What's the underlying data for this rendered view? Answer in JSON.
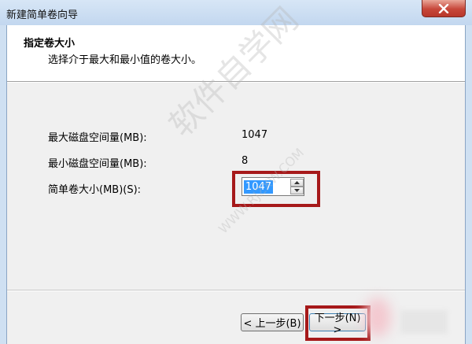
{
  "window": {
    "title": "新建简单卷向导",
    "close_icon": "close-x-icon"
  },
  "header": {
    "title": "指定卷大小",
    "subtitle": "选择介于最大和最小值的卷大小。"
  },
  "fields": {
    "max_label": "最大磁盘空间量(MB):",
    "max_value": "1047",
    "min_label": "最小磁盘空间量(MB):",
    "min_value": "8",
    "size_label": "简单卷大小(MB)(S):",
    "size_value": "1047"
  },
  "buttons": {
    "back_label": "< 上一步(B)",
    "next_label": "下一步(N) >"
  },
  "watermark": {
    "text": "软件自学网",
    "url": "WWW.RJZXW.COM"
  },
  "colors": {
    "highlight_box": "#a6191a",
    "selection": "#3399ff"
  }
}
